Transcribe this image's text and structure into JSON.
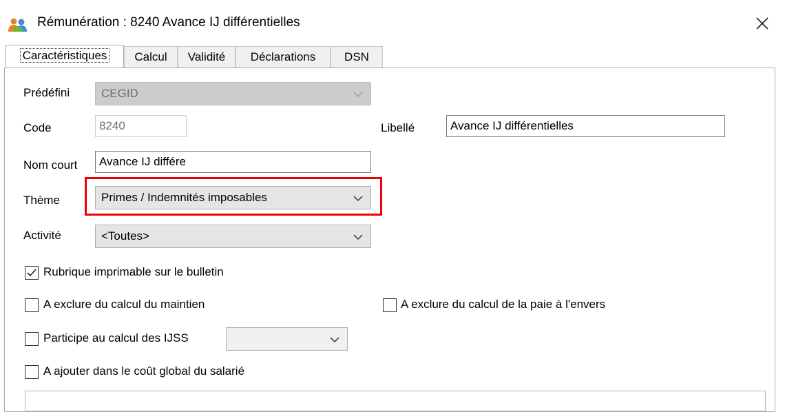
{
  "window": {
    "title": "Rémunération : 8240 Avance IJ différentielles",
    "close_glyph": "✕"
  },
  "tabs": [
    {
      "label": "Caractéristiques",
      "active": true
    },
    {
      "label": "Calcul",
      "active": false
    },
    {
      "label": "Validité",
      "active": false
    },
    {
      "label": "Déclarations",
      "active": false
    },
    {
      "label": "DSN",
      "active": false
    }
  ],
  "form": {
    "predefini": {
      "label": "Prédéfini",
      "value": "CEGID"
    },
    "code": {
      "label": "Code",
      "value": "8240"
    },
    "libelle": {
      "label": "Libellé",
      "value": "Avance IJ différentielles"
    },
    "nom_court": {
      "label": "Nom court",
      "value": "Avance IJ différe"
    },
    "theme": {
      "label": "Thème",
      "value": "Primes / Indemnités  imposables"
    },
    "activite": {
      "label": "Activité",
      "value": "<Toutes>"
    }
  },
  "checkboxes": {
    "imprimable": {
      "label": "Rubrique imprimable sur le bulletin",
      "checked": true
    },
    "exclure_maintien": {
      "label": "A exclure du calcul du maintien",
      "checked": false
    },
    "exclure_paie_envers": {
      "label": "A exclure du calcul de la paie à l'envers",
      "checked": false
    },
    "participe_ijss": {
      "label": "Participe au calcul des IJSS",
      "checked": false,
      "select_value": ""
    },
    "ajouter_cout": {
      "label": "A ajouter dans le coût global du salarié",
      "checked": false
    }
  },
  "colors": {
    "highlight": "#ee0000",
    "combo_bg": "#e5e5e5",
    "disabled_bg": "#cccccc"
  }
}
